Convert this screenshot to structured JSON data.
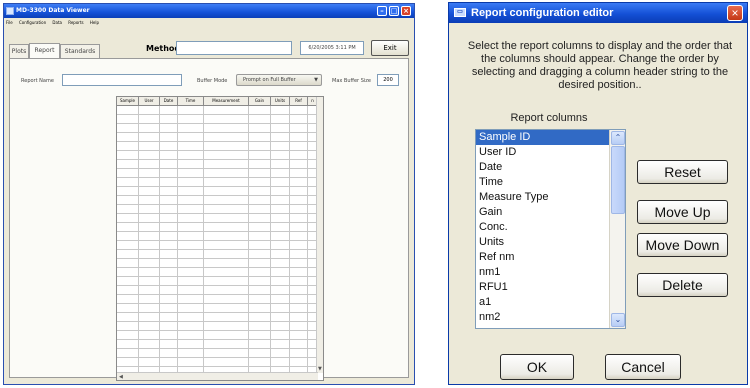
{
  "left_window": {
    "title": "MD-3300 Data Viewer",
    "menu": [
      "File",
      "Configuration",
      "Data",
      "Reports",
      "Help"
    ],
    "tabs": [
      "Plots",
      "Report",
      "Standards"
    ],
    "selected_tab": "Report",
    "method_label": "Method:",
    "method_value": "",
    "datetime": "6/20/2005 3:11 PM",
    "exit_label": "Exit",
    "report_name_label": "Report Name",
    "report_name_value": "",
    "buffer_mode_label": "Buffer Mode",
    "buffer_mode_value": "Prompt on Full Buffer",
    "max_buffer_label": "Max Buffer Size",
    "max_buffer_value": "200",
    "grid_columns": [
      "Sample",
      "User",
      "Date",
      "Time",
      "Measurement",
      "Gain",
      "Units",
      "Ref",
      "n"
    ]
  },
  "dialog": {
    "title": "Report configuration editor",
    "instructions": "Select the report columns to display and the order that the columns should appear.  Change the order by selecting and dragging a column header string to the desired position..",
    "report_columns_label": "Report columns",
    "columns": [
      "Sample ID",
      "User ID",
      "Date",
      "Time",
      "Measure Type",
      "Gain",
      "Conc.",
      "Units",
      "Ref nm",
      "nm1",
      "RFU1",
      "a1",
      "nm2"
    ],
    "selected_index": 0,
    "buttons": {
      "reset": "Reset",
      "move_up": "Move Up",
      "move_down": "Move Down",
      "delete": "Delete",
      "ok": "OK",
      "cancel": "Cancel"
    }
  }
}
